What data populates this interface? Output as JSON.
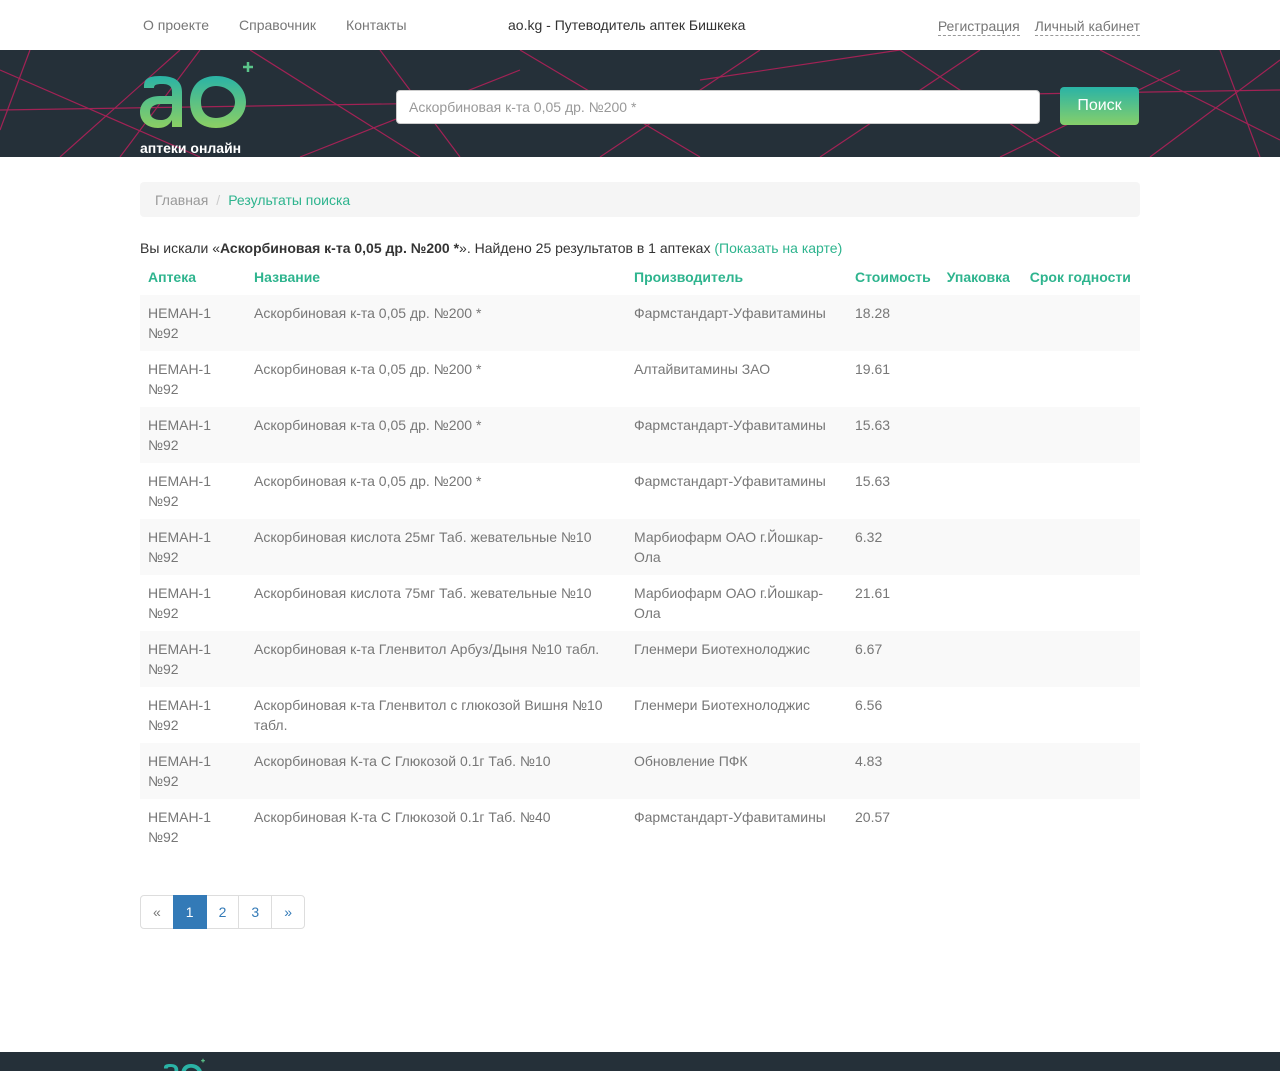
{
  "topbar": {
    "nav": [
      "О проекте",
      "Справочник",
      "Контакты"
    ],
    "site_title": "ao.kg - Путеводитель аптек Бишкека",
    "register": "Регистрация",
    "cabinet": "Личный кабинет"
  },
  "header": {
    "logo_text": "аптеки онлайн",
    "search_placeholder": "Аскорбиновая к-та 0,05 др. №200 *",
    "search_button": "Поиск"
  },
  "colors": {
    "accent": "#2eb48e",
    "banner": "#253039",
    "line": "#b8205a",
    "pagination_active": "#337ab7"
  },
  "breadcrumb": {
    "home": "Главная",
    "separator": "/",
    "current": "Результаты поиска"
  },
  "summary": {
    "prefix": "Вы искали «",
    "query": "Аскорбиновая к-та 0,05 др. №200 *",
    "suffix": "». Найдено 25 результатов в 1 аптеках",
    "map_link": "(Показать на карте)"
  },
  "table": {
    "headers": [
      "Аптека",
      "Название",
      "Производитель",
      "Стоимость",
      "Упаковка",
      "Срок годности"
    ],
    "rows": [
      {
        "pharmacy": "НЕМАН-1 №92",
        "name": "Аскорбиновая к-та 0,05 др. №200 *",
        "maker": "Фармстандарт-Уфавитамины",
        "price": "18.28"
      },
      {
        "pharmacy": "НЕМАН-1 №92",
        "name": "Аскорбиновая к-та 0,05 др. №200 *",
        "maker": "Алтайвитамины ЗАО",
        "price": "19.61"
      },
      {
        "pharmacy": "НЕМАН-1 №92",
        "name": "Аскорбиновая к-та 0,05 др. №200 *",
        "maker": "Фармстандарт-Уфавитамины",
        "price": "15.63"
      },
      {
        "pharmacy": "НЕМАН-1 №92",
        "name": "Аскорбиновая к-та 0,05 др. №200 *",
        "maker": "Фармстандарт-Уфавитамины",
        "price": "15.63"
      },
      {
        "pharmacy": "НЕМАН-1 №92",
        "name": "Аскорбиновая кислота 25мг Таб. жевательные №10",
        "maker": "Марбиофарм ОАО г.Йошкар-Ола",
        "price": "6.32"
      },
      {
        "pharmacy": "НЕМАН-1 №92",
        "name": "Аскорбиновая кислота 75мг Таб. жевательные №10",
        "maker": "Марбиофарм ОАО г.Йошкар-Ола",
        "price": "21.61"
      },
      {
        "pharmacy": "НЕМАН-1 №92",
        "name": "Аскорбиновая к-та Гленвитол Арбуз/Дыня №10 табл.",
        "maker": "Гленмери Биотехнолоджис",
        "price": "6.67"
      },
      {
        "pharmacy": "НЕМАН-1 №92",
        "name": "Аскорбиновая к-та Гленвитол с глюкозой Вишня №10 табл.",
        "maker": "Гленмери Биотехнолоджис",
        "price": "6.56"
      },
      {
        "pharmacy": "НЕМАН-1 №92",
        "name": "Аскорбиновая К-та С Глюкозой 0.1г Таб. №10",
        "maker": "Обновление ПФК",
        "price": "4.83"
      },
      {
        "pharmacy": "НЕМАН-1 №92",
        "name": "Аскорбиновая К-та С Глюкозой 0.1г Таб. №40",
        "maker": "Фармстандарт-Уфавитамины",
        "price": "20.57"
      }
    ]
  },
  "pagination": {
    "prev": "«",
    "pages": [
      "1",
      "2",
      "3"
    ],
    "current": "1",
    "next": "»"
  }
}
